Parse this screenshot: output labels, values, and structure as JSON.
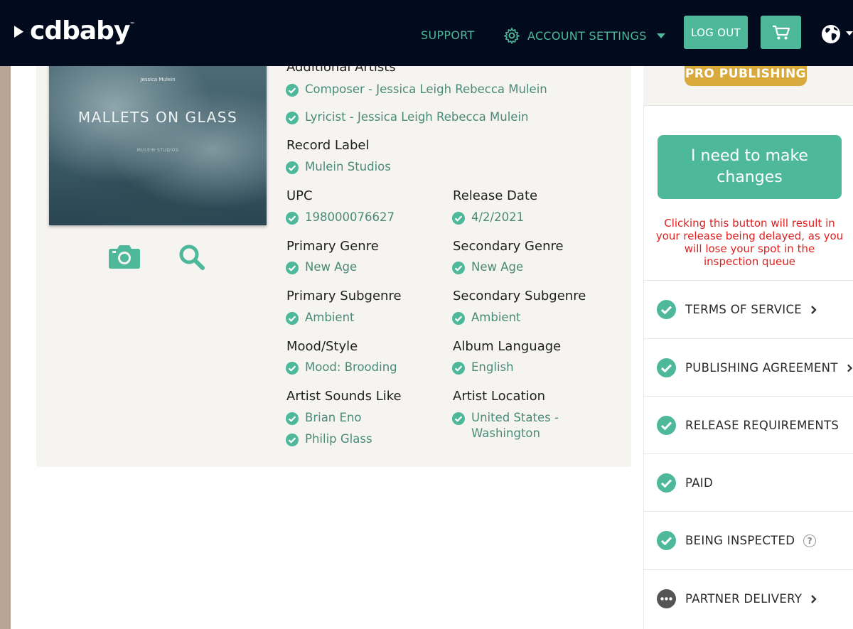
{
  "header": {
    "logo": "cdbaby",
    "nav_support": "SUPPORT",
    "nav_account": "ACCOUNT SETTINGS",
    "logout": "LOG OUT",
    "brand_color": "#4db89a",
    "header_bg": "#020a1e"
  },
  "album": {
    "cover_artist": "Jessica Mulein",
    "cover_title": "MALLETS ON GLASS",
    "cover_label": "MULEIN STUDIOS"
  },
  "details": {
    "additional_artists_label": "Additional Artists",
    "composer": "Composer - Jessica Leigh Rebecca Mulein",
    "lyricist": "Lyricist - Jessica Leigh Rebecca Mulein",
    "record_label_label": "Record Label",
    "record_label": "Mulein Studios",
    "upc_label": "UPC",
    "upc": "198000076627",
    "release_date_label": "Release Date",
    "release_date": "4/2/2021",
    "primary_genre_label": "Primary Genre",
    "primary_genre": "New Age",
    "secondary_genre_label": "Secondary Genre",
    "secondary_genre": "New Age",
    "primary_subgenre_label": "Primary Subgenre",
    "primary_subgenre": "Ambient",
    "secondary_subgenre_label": "Secondary Subgenre",
    "secondary_subgenre": "Ambient",
    "mood_label": "Mood/Style",
    "mood": "Mood: Brooding",
    "album_language_label": "Album Language",
    "album_language": "English",
    "sounds_like_label": "Artist Sounds Like",
    "sounds_like": [
      "Brian Eno",
      "Philip Glass"
    ],
    "artist_location_label": "Artist Location",
    "artist_location_line1": "United States -",
    "artist_location_line2": "Washington"
  },
  "sidebar": {
    "pro_badge": "PRO PUBLISHING",
    "changes_button": "I need to make changes",
    "warning": "Clicking this button will result in your release being delayed, as you will lose your spot in the inspection queue",
    "status_items": [
      {
        "label": "TERMS OF SERVICE",
        "state": "done"
      },
      {
        "label": "PUBLISHING AGREEMENT",
        "state": "done"
      },
      {
        "label": "RELEASE REQUIREMENTS",
        "state": "done"
      },
      {
        "label": "PAID",
        "state": "done"
      },
      {
        "label": "BEING INSPECTED",
        "state": "done"
      },
      {
        "label": "PARTNER DELIVERY",
        "state": "pending"
      }
    ]
  }
}
